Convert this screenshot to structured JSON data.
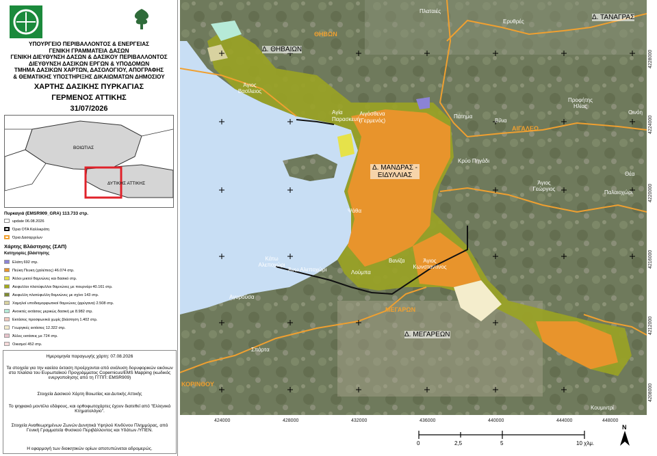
{
  "header": {
    "lines": [
      "ΥΠΟΥΡΓΕΙΟ ΠΕΡΙΒΑΛΛΟΝΤΟΣ & ΕΝΕΡΓΕΙΑΣ",
      "ΓΕΝΙΚΗ ΓΡΑΜΜΑΤΕΙΑ ΔΑΣΩΝ",
      "ΓΕΝΙΚΗ ΔΙΕΥΘΥΝΣΗ ΔΑΣΩΝ & ΔΑΣΙΚΟΥ ΠΕΡΙΒΑΛΛΟΝΤΟΣ",
      "ΔΙΕΥΘΥΝΣΗ ΔΑΣΙΚΩΝ ΕΡΓΩΝ & ΥΠΟΔΟΜΩΝ",
      "ΤΜΗΜΑ ΔΑΣΙΚΩΝ ΧΑΡΤΩΝ, ΔΑΣΟΛΟΓΙΟΥ, ΑΠΟΓΡΑΦΗΣ",
      "& ΘΕΜΑΤΙΚΗΣ ΥΠΟΣΤΗΡΙΞΗΣ ΔΙΚΑΙΩΜΑΤΩΝ ΔΗΜΟΣΙΟΥ"
    ],
    "title": "ΧΑΡΤΗΣ ΔΑΣΙΚΗΣ ΠΥΡΚΑΓΙΑΣ",
    "subtitle": "ΓΕΡΜΕΝΟΣ ΑΤΤΙΚΗΣ",
    "date": "31/07/2026"
  },
  "inset": {
    "label_north": "ΒΟΙΩΤΙΑΣ",
    "label_south": "ΔΥΤΙΚΗΣ ΑΤΤΙΚΗΣ"
  },
  "legend": {
    "fire_title": "Πυρκαγιά (EMSR909_GRA)  113.733 στρ.",
    "fire_update": "update 06.08.2026",
    "ota": "Όρια ΟΤΑ Καλλικράτη",
    "forestry": "Όρια Δασαρχείων",
    "veg_title": "Χάρτης Βλάστησης (ΣΑΠ)",
    "cat_title": "Κατηγορίες βλάστησης",
    "items": [
      {
        "label": "Ελάτη 692 στρ.",
        "color": "#8b83d6"
      },
      {
        "label": "Πεύκη Πευκη (χαλέπιος) 46.074 στρ.",
        "color": "#e8942c"
      },
      {
        "label": "Άλλοι μικτοί θαμνώνες και δασικό στρ.",
        "color": "#e6e24a"
      },
      {
        "label": "Αειφυλλοι πλατύφυλλοι θαμνώνες με πουρνάρι 40.161 στρ.",
        "color": "#a4aa1c"
      },
      {
        "label": "Αειφυλλη πλατύφυλλη θαμνώνες με σχίνο 143 στρ.",
        "color": "#7f8a32"
      },
      {
        "label": "Χαμηλοί υποδιαμορφωτικοί θαμνώνες (φρύγανα) 2.508 στρ.",
        "color": "#d8d2a0"
      },
      {
        "label": "Ανοικτές εκτάσεις μερικώς δασική με 8.982 στρ.",
        "color": "#b6ead8"
      },
      {
        "label": "Εκτάσεις προσφωνικά χωρίς βλάστηση 1.402 στρ.",
        "color": "#f2c8bc"
      },
      {
        "label": "Γεωργικές εκτάσεις 12.322 στρ.",
        "color": "#f4edcc"
      },
      {
        "label": "Άλλες εκτάσεις με 724 στρ.",
        "color": "#e8c4cc"
      },
      {
        "label": "Οικισμοί 452 στρ.",
        "color": "#f5dada"
      }
    ]
  },
  "info": {
    "date": "Ημερομηνία παραγωγής χάρτη: 07.08.2026",
    "p1": "Τα στοιχεία για την καείσα έκταση προέρχονται από ανάλυση δορυφορικών εικόνων στα πλαίσια του Ευρωπαϊκού Προγράμματος Copernicus/EMS Mapping (κωδικός ενεργοποίησης από τη ΓΓΠΠ: EMSR909)",
    "p2": "Στοιχεία Δασικού Χάρτη Βοιωτίας και Δυτικής Αττικής",
    "p3": "Το ψηφιακό μοντέλο εδάφους, και ορθοφωτοχάρτες έχουν διατεθεί από \"Ελληνικό Κτηματολόγιο\".",
    "p4": "Στοιχεία Αναθεωρημένων Ζωνών Δυνητικά Υψηλού Κινδύνου Πλημμύρας, από Γενική Γραμματεία Φυσικού Περιβάλλοντος και Υδάτων /ΥΠΕΝ.",
    "p5": "Η εφαρμογή των διοικητικών ορίων αποτυπώνεται αδρομερώς."
  },
  "map": {
    "places": {
      "thivaion": "Δ. ΘΗΒΑΙΩΝ",
      "thivon": "ΘΗΒΩΝ",
      "tanagras": "Δ. ΤΑΝΑΓΡΑΣ",
      "plataies": "Πλαταιές",
      "erythres": "Ερυθρές",
      "agios_vasileios": "Άγιος Βασίλειος",
      "agia_paraskevi": "Αγία Παρασκευή",
      "aigosthena": "Αιγόσθενα (Γερμενός)",
      "patima": "Πάτημα",
      "profitis": "Προφήτης Ηλίας",
      "oinoi": "Οινόη",
      "vilia": "Βίλια",
      "aigaleo": "ΑΙΓΑΛΕΩ",
      "mandra": "Δ. ΜΑΝΔΡΑΣ - ΕΙΔΥΛΛΙΑΣ",
      "kryo": "Κρύο Πηγάδι",
      "agios_georgios": "Άγιος Γεώργιος",
      "palaiochori": "Παλαιοχώρι",
      "psatha": "Ψάθα",
      "kato_alepochori": "Κάτω Αλεποχώρι",
      "ano_alepochori": "Άνω Αλεποχώρι",
      "vaniza": "Βανίζα",
      "agios_konstantinos": "Άγιος Κωνσταντίνος",
      "loumpa": "Λούμπα",
      "agyrousa": "Αγυρούσα",
      "megaron": "ΜΕΓΑΡΩΝ",
      "d_megaron": "Δ. ΜΕΓΑΡΕΩΝ",
      "sparta": "Σπάρτα",
      "korinthou": "ΚΟΡΙΝΘΟΥ",
      "koumintri": "Κουμιντρί",
      "thea": "Θέα"
    },
    "x_ticks": [
      "424000",
      "428000",
      "432000",
      "436000",
      "440000",
      "444000",
      "448000"
    ],
    "y_ticks": [
      "4228000",
      "4224000",
      "4220000",
      "4216000",
      "4212000",
      "4208000"
    ]
  },
  "scale": {
    "ticks": [
      "0",
      "2,5",
      "5",
      "10 χλμ."
    ]
  },
  "north": "N"
}
